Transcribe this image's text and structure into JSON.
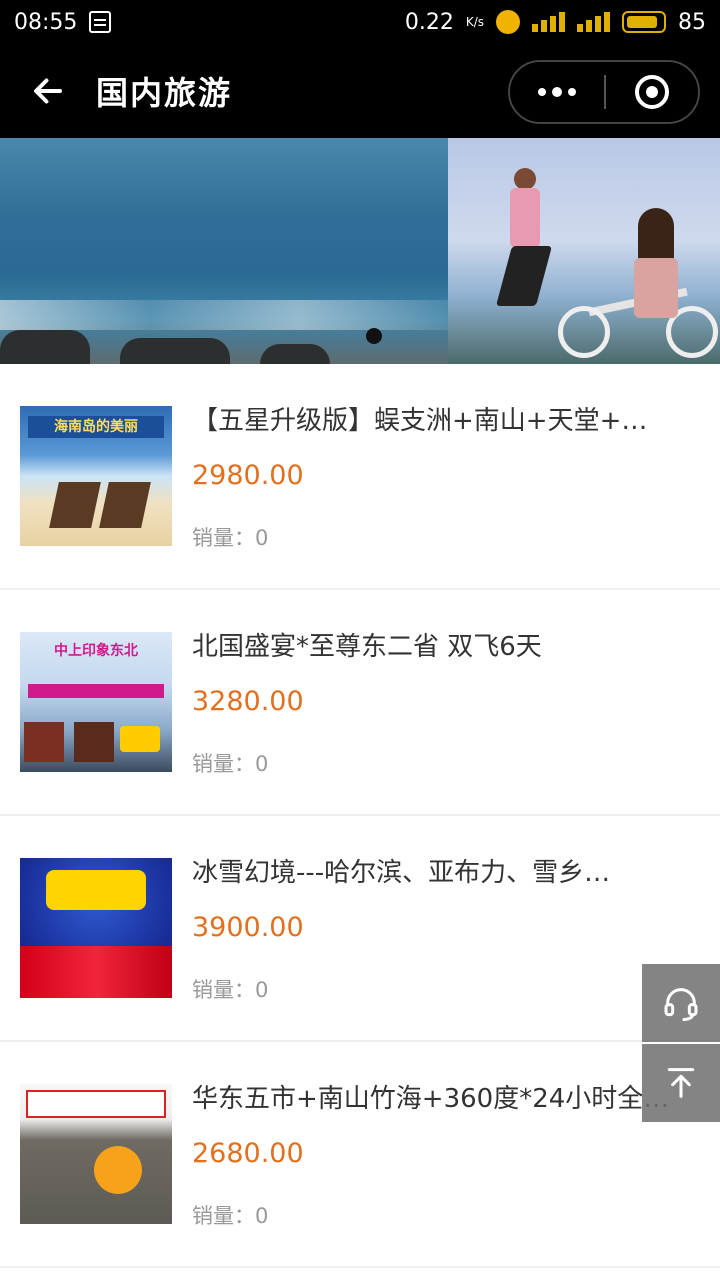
{
  "status_bar": {
    "time": "08:55",
    "network_speed": "0.22",
    "network_speed_unit": "K/s",
    "battery": "85"
  },
  "nav": {
    "title": "国内旅游",
    "icons": {
      "back": "back-arrow-icon",
      "more": "more-dots-icon",
      "close": "close-target-icon"
    }
  },
  "banner": {
    "slides": [
      "sea-coast",
      "jumping-couple-bike"
    ],
    "active_index": 0
  },
  "products": [
    {
      "name": "【五星升级版】蜈支洲+南山+天堂+…",
      "price": "2980.00",
      "sales": "销量：0",
      "thumb_text": "海南岛的美丽"
    },
    {
      "name": "北国盛宴*至尊东二省 双飞6天",
      "price": "3280.00",
      "sales": "销量：0",
      "thumb_text": "中上印象东北"
    },
    {
      "name": "冰雪幻境---哈尔滨、亚布力、雪乡…",
      "price": "3900.00",
      "sales": "销量：0",
      "thumb_text": ""
    },
    {
      "name": "华东五市+南山竹海+360度*24小时全…",
      "price": "2680.00",
      "sales": "销量：0",
      "thumb_text": ""
    }
  ],
  "floating": {
    "service": "headset-icon",
    "top": "back-to-top-icon"
  },
  "colors": {
    "price": "#e2701f",
    "bar": "#000000",
    "accent_battery": "#e0b000"
  }
}
